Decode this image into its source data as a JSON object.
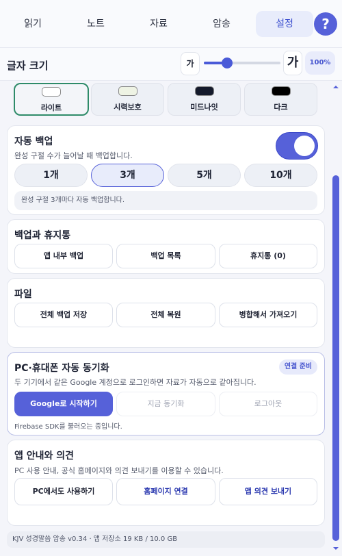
{
  "nav": {
    "tabs": [
      {
        "label": "읽기"
      },
      {
        "label": "노트"
      },
      {
        "label": "자료"
      },
      {
        "label": "암송"
      },
      {
        "label": "설정",
        "active": true
      }
    ],
    "help_label": "?"
  },
  "font_size": {
    "title": "글자 크기",
    "small_label": "가",
    "large_label": "가",
    "percent_label": "100%",
    "slider_value": 0.3
  },
  "theme": {
    "options": [
      {
        "label": "라이트",
        "swatch": "#ffffff",
        "selected": true
      },
      {
        "label": "시력보호",
        "swatch": "#eef3e4"
      },
      {
        "label": "미드나잇",
        "swatch": "#141a2b"
      },
      {
        "label": "다크",
        "swatch": "#000000"
      }
    ]
  },
  "auto_backup": {
    "title": "자동 백업",
    "desc": "완성 구절 수가 늘어날 때 백업합니다.",
    "enabled": true,
    "options": [
      "1개",
      "3개",
      "5개",
      "10개"
    ],
    "selected": "3개",
    "note": "완성 구절 3개마다 자동 백업합니다."
  },
  "backup_trash": {
    "title": "백업과 휴지통",
    "buttons": [
      "앱 내부 백업",
      "백업 목록",
      "휴지통 (0)"
    ]
  },
  "file": {
    "title": "파일",
    "buttons": [
      "전체 백업 저장",
      "전체 복원",
      "병합해서 가져오기"
    ]
  },
  "sync": {
    "title": "PC·휴대폰 자동 동기화",
    "badge": "연결 준비",
    "desc": "두 기기에서 같은 Google 계정으로 로그인하면 자료가 자동으로 같아집니다.",
    "buttons": [
      "Google로 시작하기",
      "지금 동기화",
      "로그아웃"
    ],
    "status": "Firebase SDK를 불러오는 중입니다."
  },
  "about": {
    "title": "앱 안내와 의견",
    "desc": "PC 사용 안내, 공식 홈페이지와 의견 보내기를 이용할 수 있습니다.",
    "buttons": [
      "PC에서도 사용하기",
      "홈페이지 연결",
      "앱 의견 보내기"
    ]
  },
  "footer": "KJV 성경말씀 암송 v0.34 · 앱 저장소 19 KB / 10.0 GB",
  "colors": {
    "accent": "#5661d9",
    "accent_light": "#e8ecfb",
    "background": "#f4f5fa"
  }
}
